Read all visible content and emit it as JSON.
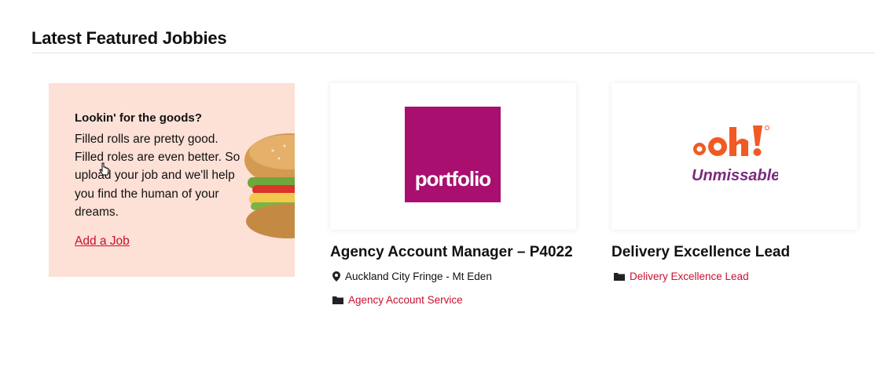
{
  "section": {
    "title": "Latest Featured Jobbies"
  },
  "promo": {
    "heading": "Lookin' for the goods?",
    "body": "Filled rolls are pretty good. Filled roles are even better. So upload your job and we'll help you find the human of your dreams.",
    "link_label": "Add a Job",
    "background_color": "#fde0d6"
  },
  "jobs": [
    {
      "logo_text": "portfolio",
      "title": "Agency Account Manager – P4022",
      "location": "Auckland City Fringe - Mt Eden",
      "category": "Agency Account Service",
      "logo_color": "#a80f6f"
    },
    {
      "logo_text": "ooh!",
      "logo_tagline": "Unmissable",
      "title": "Delivery Excellence Lead",
      "category": "Delivery Excellence Lead",
      "logo_color": "#f15a22"
    }
  ],
  "colors": {
    "accent": "#c8102e",
    "text": "#111111"
  }
}
